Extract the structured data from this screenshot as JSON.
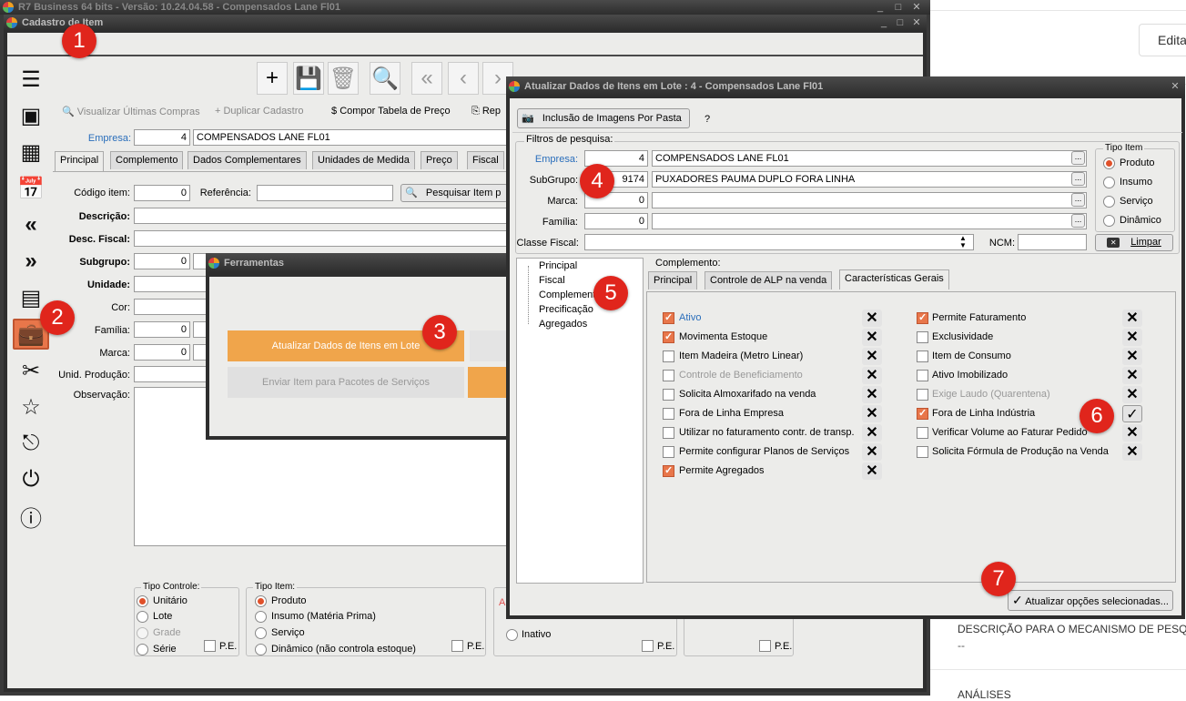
{
  "app": {
    "title": "R7 Business 64 bits - Versão: 10.24.04.58 - Compensados Lane Fl01"
  },
  "cad": {
    "title": "Cadastro de Item",
    "toolbar2": [
      "Visualizar Últimas Compras",
      "Duplicar Cadastro",
      "Compor Tabela de Preço",
      "Rep"
    ],
    "empresa_label": "Empresa:",
    "empresa_code": "4",
    "empresa_name": "COMPENSADOS LANE FL01",
    "tabs": [
      "Principal",
      "Complemento",
      "Dados Complementares",
      "Unidades de Medida",
      "Preço",
      "Fiscal"
    ],
    "fields": {
      "codigo_label": "Código item:",
      "codigo": "0",
      "referencia_label": "Referência:",
      "pesquisar": "Pesquisar Item p",
      "descricao": "Descrição:",
      "desc_fiscal": "Desc. Fiscal:",
      "subgrupo": "Subgrupo:",
      "subgrupo_val": "0",
      "unidade": "Unidade:",
      "cor": "Cor:",
      "familia": "Família:",
      "familia_val": "0",
      "marca": "Marca:",
      "marca_val": "0",
      "unid_producao": "Unid. Produção:",
      "observacao": "Observação:"
    },
    "tipo_controle": {
      "title": "Tipo Controle:",
      "options": [
        "Unitário",
        "Lote",
        "Grade",
        "Série"
      ],
      "pe": "P.E."
    },
    "tipo_item": {
      "title": "Tipo Item:",
      "options": [
        "Produto",
        "Insumo (Matéria Prima)",
        "Serviço",
        "Dinâmico (não controla estoque)"
      ],
      "pe": "P.E."
    },
    "grp3": {
      "marker": "A",
      "option": "Inativo",
      "pe": "P.E."
    },
    "grp4": {
      "pe": "P.E."
    }
  },
  "ferr": {
    "title": "Ferramentas",
    "btn1": "Atualizar Dados de Itens em Lote",
    "btn2": "Enviar Item para Pacotes de Serviços"
  },
  "lote": {
    "title": "Atualizar Dados de Itens em Lote : 4 - Compensados Lane Fl01",
    "img_btn": "Inclusão de Imagens Por Pasta",
    "help": "?",
    "filtros": "Filtros de pesquisa:",
    "empresa_label": "Empresa:",
    "empresa_code": "4",
    "empresa_name": "COMPENSADOS LANE FL01",
    "subgrupo_label": "SubGrupo:",
    "subgrupo_code": "9174",
    "subgrupo_name": "PUXADORES PAUMA DUPLO FORA LINHA",
    "marca_label": "Marca:",
    "marca_code": "0",
    "familia_label": "Família:",
    "familia_code": "0",
    "classe_label": "Classe Fiscal:",
    "ncm_label": "NCM:",
    "limpar": "Limpar",
    "tipo_item": {
      "title": "Tipo Item",
      "options": [
        "Produto",
        "Insumo",
        "Serviço",
        "Dinâmico"
      ]
    },
    "tree": [
      "Principal",
      "Fiscal",
      "Complemento",
      "Precificação",
      "Agregados"
    ],
    "complemento": "Complemento:",
    "tabs": [
      "Principal",
      "Controle de ALP na venda",
      "Características Gerais"
    ],
    "left": [
      {
        "label": "Ativo",
        "checked": true
      },
      {
        "label": "Movimenta Estoque",
        "checked": true
      },
      {
        "label": "Item Madeira (Metro Linear)",
        "checked": false
      },
      {
        "label": "Controle de Beneficiamento",
        "checked": false
      },
      {
        "label": "Solicita Almoxarifado na venda",
        "checked": false
      },
      {
        "label": "Fora de Linha Empresa",
        "checked": false
      },
      {
        "label": "Utilizar no faturamento contr. de transp.",
        "checked": false
      },
      {
        "label": "Permite configurar Planos de Serviços",
        "checked": false
      },
      {
        "label": "Permite Agregados",
        "checked": true
      }
    ],
    "right": [
      {
        "label": "Permite Faturamento",
        "checked": true
      },
      {
        "label": "Exclusividade",
        "checked": false
      },
      {
        "label": "Item de Consumo",
        "checked": false
      },
      {
        "label": "Ativo Imobilizado",
        "checked": false
      },
      {
        "label": "Exige Laudo (Quarentena)",
        "checked": false
      },
      {
        "label": "Fora de Linha Indústria",
        "checked": true
      },
      {
        "label": "Verificar Volume ao Faturar Pedido",
        "checked": false
      },
      {
        "label": "Solicita Fórmula de Produção na Venda",
        "checked": false
      }
    ],
    "atualizar": "Atualizar opções selecionadas..."
  },
  "bg": {
    "edit": "Edita",
    "desc": "DESCRIÇÃO PARA O MECANISMO DE PESQ",
    "dash": "--",
    "analises": "ANÁLISES"
  },
  "badges": [
    "1",
    "2",
    "3",
    "4",
    "5",
    "6",
    "7"
  ]
}
